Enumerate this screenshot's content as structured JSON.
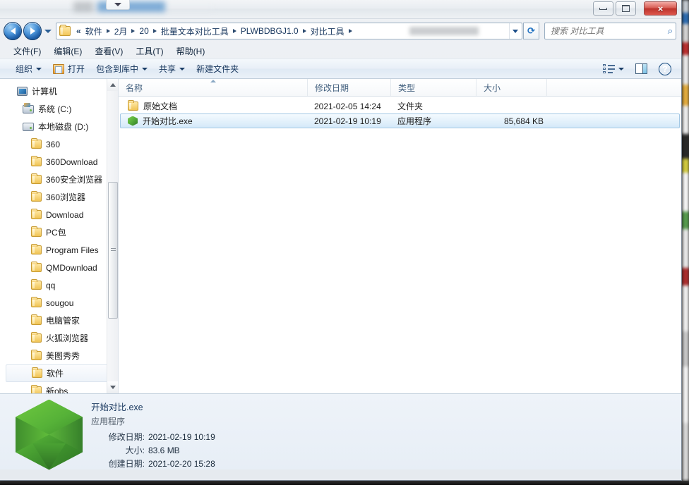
{
  "window": {
    "title_redacted": true,
    "controls": {
      "minimize": "最小化",
      "maximize": "最大化",
      "close": "×"
    }
  },
  "nav": {
    "back_label": "后退",
    "forward_label": "前进",
    "history_label": "最近浏览的页面",
    "refresh_label": "刷新",
    "breadcrumb_overflow": "«",
    "breadcrumbs": [
      {
        "label": "软件"
      },
      {
        "label": "2月"
      },
      {
        "label": "20"
      },
      {
        "label": "批量文本对比工具"
      },
      {
        "label": "PLWBDBGJ1.0"
      },
      {
        "label": "对比工具"
      }
    ]
  },
  "search": {
    "placeholder": "搜索 对比工具",
    "value": "",
    "icon": "search-icon"
  },
  "menubar": {
    "items": [
      {
        "text": "文件(F)"
      },
      {
        "text": "编辑(E)"
      },
      {
        "text": "查看(V)"
      },
      {
        "text": "工具(T)"
      },
      {
        "text": "帮助(H)"
      }
    ]
  },
  "toolbar": {
    "organize": "组织",
    "open": "打开",
    "include_in_library": "包含到库中",
    "share": "共享",
    "new_folder": "新建文件夹",
    "view_options_label": "更改您的视图",
    "preview_pane_label": "显示预览窗格",
    "help_label": "?"
  },
  "navpane": {
    "items": [
      {
        "label": "计算机",
        "icon": "computer-icon",
        "level": 1,
        "selected": false
      },
      {
        "label": "系统 (C:)",
        "icon": "system-drive-icon",
        "level": 2,
        "selected": false
      },
      {
        "label": "本地磁盘 (D:)",
        "icon": "drive-icon",
        "level": 2,
        "selected": false
      },
      {
        "label": "360",
        "icon": "folder-icon",
        "level": 3,
        "selected": false
      },
      {
        "label": "360Download",
        "icon": "folder-icon",
        "level": 3,
        "selected": false
      },
      {
        "label": "360安全浏览器",
        "icon": "folder-icon",
        "level": 3,
        "selected": false
      },
      {
        "label": "360浏览器",
        "icon": "folder-icon",
        "level": 3,
        "selected": false
      },
      {
        "label": "Download",
        "icon": "folder-icon",
        "level": 3,
        "selected": false
      },
      {
        "label": "PC包",
        "icon": "folder-icon",
        "level": 3,
        "selected": false
      },
      {
        "label": "Program Files",
        "icon": "folder-icon",
        "level": 3,
        "selected": false
      },
      {
        "label": "QMDownload",
        "icon": "folder-icon",
        "level": 3,
        "selected": false
      },
      {
        "label": "qq",
        "icon": "folder-icon",
        "level": 3,
        "selected": false
      },
      {
        "label": "sougou",
        "icon": "folder-icon",
        "level": 3,
        "selected": false
      },
      {
        "label": "电脑管家",
        "icon": "folder-icon",
        "level": 3,
        "selected": false
      },
      {
        "label": "火狐浏览器",
        "icon": "folder-icon",
        "level": 3,
        "selected": false
      },
      {
        "label": "美图秀秀",
        "icon": "folder-icon",
        "level": 3,
        "selected": false
      },
      {
        "label": "软件",
        "icon": "folder-icon",
        "level": 3,
        "selected": true
      },
      {
        "label": "新obs",
        "icon": "folder-icon",
        "level": 3,
        "selected": false
      }
    ]
  },
  "filelist": {
    "columns": [
      {
        "key": "name",
        "label": "名称",
        "sorted": "asc"
      },
      {
        "key": "date",
        "label": "修改日期"
      },
      {
        "key": "type",
        "label": "类型"
      },
      {
        "key": "size",
        "label": "大小"
      }
    ],
    "rows": [
      {
        "icon": "folder-icon",
        "name": "原始文档",
        "date": "2021-02-05 14:24",
        "type": "文件夹",
        "size": "",
        "selected": false
      },
      {
        "icon": "hexagon-app-icon",
        "name": "开始对比.exe",
        "date": "2021-02-19 10:19",
        "type": "应用程序",
        "size": "85,684 KB",
        "selected": true
      }
    ]
  },
  "details": {
    "icon": "hexagon-app-icon-large",
    "title": "开始对比.exe",
    "subtitle": "应用程序",
    "fields": [
      {
        "label": "修改日期:",
        "value": "2021-02-19 10:19"
      },
      {
        "label": "大小:",
        "value": "83.6 MB"
      },
      {
        "label": "创建日期:",
        "value": "2021-02-20 15:28"
      }
    ]
  },
  "colors": {
    "selection_border": "#a3c8e5",
    "selection_fill": "#d4e9f9",
    "accent_blue": "#17365d",
    "close_red": "#bc332c",
    "app_green": "#56b238",
    "folder_yellow": "#f0c354"
  }
}
